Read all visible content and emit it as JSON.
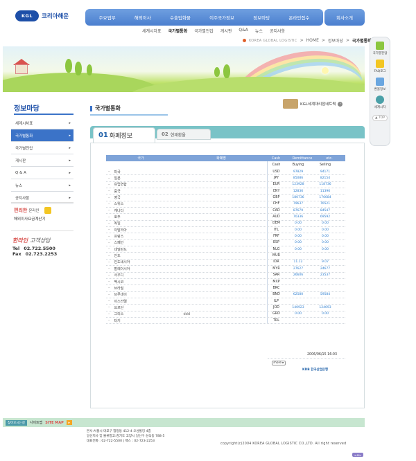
{
  "header": {
    "logo_mark": "KGL",
    "logo_name": "코리아해운",
    "gnb": [
      "주요업무",
      "해외이사",
      "수출입화물",
      "이주국가정보",
      "정보마당",
      "온라인접수"
    ],
    "intro": "회사소개",
    "subnav": [
      "세계시차표",
      "국가별통화",
      "국가별전압",
      "게시판",
      "Q&A",
      "뉴스",
      "공지사항"
    ],
    "subnav_active": "국가별통화"
  },
  "breadcrumb": {
    "corp": "KOREA GLOBAL LOGISTIC",
    "sep1": ">",
    "home": "HOME",
    "sep2": ">",
    "section": "정보마당",
    "sep3": ">",
    "current": "국가별통화"
  },
  "quick_menu": {
    "items": [
      {
        "label": "국가별전압",
        "color": "#8cc63f"
      },
      {
        "label": "FAQ로그",
        "color": "#f3c623"
      },
      {
        "label": "환율정보",
        "color": "#6aa6e0"
      },
      {
        "label": "세계시차",
        "color": "#4aa0a8"
      }
    ],
    "top": "▲ TOP"
  },
  "sidebar": {
    "title": "정보마당",
    "items": [
      {
        "label": "세계시차표",
        "active": false
      },
      {
        "label": "국가별통화",
        "active": true
      },
      {
        "label": "국가별전압",
        "active": false
      },
      {
        "label": "게시판",
        "active": false
      },
      {
        "label": "Q & A",
        "active": false
      },
      {
        "label": "뉴스",
        "active": false
      },
      {
        "label": "공지사항",
        "active": false
      }
    ],
    "arrow": "▸",
    "calc": {
      "l1_a": "편리한",
      "l1_b": "온라인",
      "l2": "해외이사요금계산기"
    },
    "cs": {
      "title_a": "한라인",
      "title_b": "고객상담",
      "tel_label": "Tel",
      "tel": "02.722.5500",
      "fax_label": "Fax",
      "fax": "02.723.2253"
    }
  },
  "content": {
    "page_title": "국가별통화",
    "logi_link": "KGL세계대리점네트웍",
    "logi_go": "›",
    "tab1": {
      "num": "01",
      "label": "화폐정보"
    },
    "tab2": {
      "num": "02",
      "label": "현재환율"
    }
  },
  "rate_table": {
    "headers": {
      "country": "국가",
      "note": "화폐명",
      "cash": "Cash",
      "remit": "Remittance",
      "etc": "etc."
    },
    "sub": {
      "code": "Cash",
      "buy": "Buying",
      "sell": "Selling"
    },
    "rows": [
      {
        "name": "미국",
        "note": "",
        "code": "USD",
        "buy": "97829",
        "sell": "94171"
      },
      {
        "name": "일본",
        "note": "",
        "code": "JPY",
        "buy": "85086",
        "sell": "82154"
      },
      {
        "name": "유럽연합",
        "note": "",
        "code": "EUR",
        "buy": "123928",
        "sell": "118736"
      },
      {
        "name": "중국",
        "note": "",
        "code": "CNY",
        "buy": "12836",
        "sell": "11396"
      },
      {
        "name": "영국",
        "note": "",
        "code": "GBP",
        "buy": "180736",
        "sell": "176684"
      },
      {
        "name": "스위스",
        "note": "",
        "code": "CHF",
        "buy": "79637",
        "sell": "76521"
      },
      {
        "name": "캐나다",
        "note": "",
        "code": "CAD",
        "buy": "87679",
        "sell": "84547"
      },
      {
        "name": "호주",
        "note": "",
        "code": "AUD",
        "buy": "70336",
        "sell": "69592"
      },
      {
        "name": "독일",
        "note": "",
        "code": "DEM",
        "buy": "0.00",
        "sell": "0.00"
      },
      {
        "name": "이탈리아",
        "note": "",
        "code": "ITL",
        "buy": "0.00",
        "sell": "0.00"
      },
      {
        "name": "프랑스",
        "note": "",
        "code": "FRF",
        "buy": "0.00",
        "sell": "0.00"
      },
      {
        "name": "스페인",
        "note": "",
        "code": "ESP",
        "buy": "0.00",
        "sell": "0.00"
      },
      {
        "name": "네덜란드",
        "note": "",
        "code": "NLG",
        "buy": "0.00",
        "sell": "0.00"
      },
      {
        "name": "인도",
        "note": "",
        "code": "MUR",
        "buy": "",
        "sell": ""
      },
      {
        "name": "인도네시아",
        "note": "",
        "code": "IDR",
        "buy": "11.12",
        "sell": "9.07"
      },
      {
        "name": "말레이시아",
        "note": "",
        "code": "MYR",
        "buy": "27627",
        "sell": "24677"
      },
      {
        "name": "사우디",
        "note": "",
        "code": "SAR",
        "buy": "26606",
        "sell": "23537"
      },
      {
        "name": "멕시코",
        "note": "",
        "code": "MXP",
        "buy": "",
        "sell": ""
      },
      {
        "name": "브라질",
        "note": "",
        "code": "BRC",
        "buy": "",
        "sell": ""
      },
      {
        "name": "브루네이",
        "note": "",
        "code": "BND",
        "buy": "62580",
        "sell": "59584"
      },
      {
        "name": "이스라엘",
        "note": "",
        "code": "ILP",
        "buy": "",
        "sell": ""
      },
      {
        "name": "요르단",
        "note": "",
        "code": "JOD",
        "buy": "140923",
        "sell": "124693"
      },
      {
        "name": "그리스",
        "note": "ddd",
        "code": "GRD",
        "buy": "0.00",
        "sell": "0.00"
      },
      {
        "name": "터키",
        "note": "",
        "code": "TRL",
        "buy": "",
        "sell": ""
      }
    ],
    "date": "2006/06/15 16:03",
    "more": "more ▸",
    "kdb": "KDB 한국산업은행"
  },
  "footer": {
    "b1": "찾아오시는길",
    "b2": "사이트맵",
    "b3": "SITE MAP",
    "b4": "▸",
    "addr1": "본사:서울시 마포구 합정동 412-4 오성빌딩 4층",
    "addr2": "일산지사 및 물류창고:경기도 고양시 일산구 성석동 788-5",
    "addr3": "대표전화 : 02-722-5500 | 팩스 : 02-723-2253",
    "copyright": "copyright(c)2004 KOREA GLOBAL LOGISTIC CO.,LTD. All right reserved",
    "badge": "e-Biz"
  }
}
